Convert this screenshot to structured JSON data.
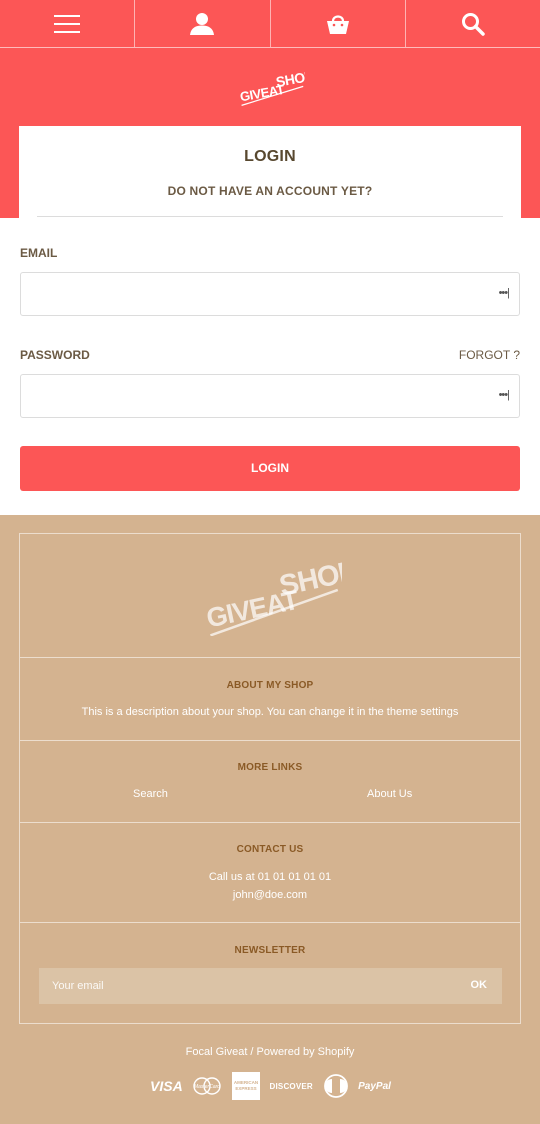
{
  "header": {
    "icons": [
      "menu-icon",
      "account-icon",
      "cart-icon",
      "search-icon"
    ]
  },
  "brand": {
    "logo_text": "GIVEATSHOP"
  },
  "login": {
    "title": "LOGIN",
    "subtitle": "DO NOT HAVE AN ACCOUNT YET?",
    "email_label": "EMAIL",
    "email_value": "",
    "password_label": "PASSWORD",
    "password_value": "",
    "forgot_label": "FORGOT ?",
    "submit_label": "LOGIN",
    "autofill_indicator": "•••|"
  },
  "footer": {
    "logo_text": "GIVEATSHOP",
    "about": {
      "heading": "ABOUT MY SHOP",
      "text": "This is a description about your shop. You can change it in the theme settings"
    },
    "more_links": {
      "heading": "MORE LINKS",
      "links": [
        "Search",
        "About Us"
      ]
    },
    "contact": {
      "heading": "CONTACT US",
      "phone": "Call us at 01 01 01 01 01",
      "email": "john@doe.com"
    },
    "newsletter": {
      "heading": "NEWSLETTER",
      "placeholder": "Your email",
      "button": "OK"
    },
    "powered": "Focal Giveat / Powered by Shopify",
    "payments": [
      "VISA",
      "MasterCard",
      "American Express",
      "DISCOVER",
      "Diners Club",
      "PayPal"
    ]
  },
  "colors": {
    "primary": "#fc5656",
    "footer_bg": "#d4b390",
    "heading_brown": "#8a5a26",
    "text_dark": "#6b5a44"
  }
}
